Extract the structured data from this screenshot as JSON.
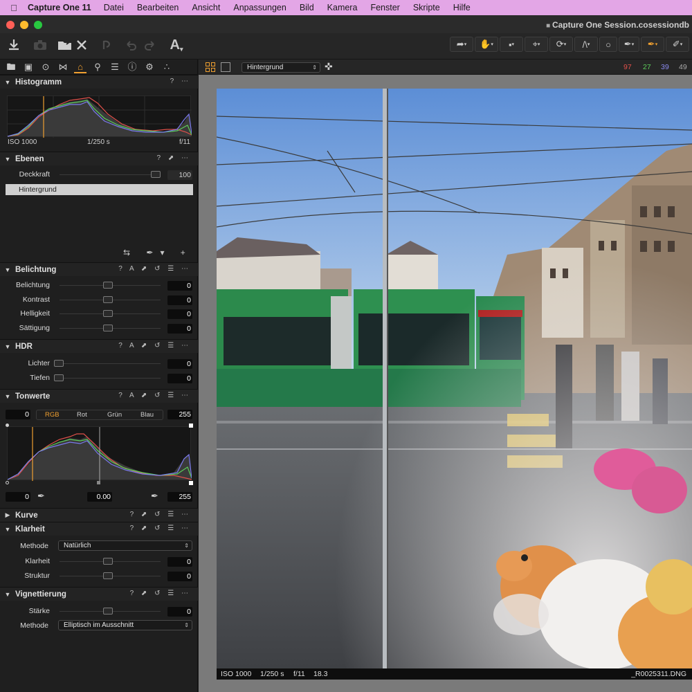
{
  "menubar": {
    "app": "Capture One 11",
    "items": [
      "Datei",
      "Bearbeiten",
      "Ansicht",
      "Anpassungen",
      "Bild",
      "Kamera",
      "Fenster",
      "Skripte",
      "Hilfe"
    ]
  },
  "window": {
    "title": "Capture One Session.cosessiondb"
  },
  "histogram": {
    "title": "Histogramm",
    "iso": "ISO 1000",
    "shutter": "1/250 s",
    "aperture": "f/11"
  },
  "layers": {
    "title": "Ebenen",
    "opacity_label": "Deckkraft",
    "opacity_value": "100",
    "layer_name": "Hintergrund"
  },
  "exposure": {
    "title": "Belichtung",
    "rows": [
      {
        "label": "Belichtung",
        "value": "0"
      },
      {
        "label": "Kontrast",
        "value": "0"
      },
      {
        "label": "Helligkeit",
        "value": "0"
      },
      {
        "label": "Sättigung",
        "value": "0"
      }
    ]
  },
  "hdr": {
    "title": "HDR",
    "rows": [
      {
        "label": "Lichter",
        "value": "0"
      },
      {
        "label": "Tiefen",
        "value": "0"
      }
    ]
  },
  "levels": {
    "title": "Tonwerte",
    "low": "0",
    "high": "255",
    "channels": [
      "RGB",
      "Rot",
      "Grün",
      "Blau"
    ],
    "out_low": "0",
    "mid": "0.00",
    "out_high": "255"
  },
  "curve": {
    "title": "Kurve"
  },
  "clarity": {
    "title": "Klarheit",
    "method_label": "Methode",
    "method_value": "Natürlich",
    "rows": [
      {
        "label": "Klarheit",
        "value": "0"
      },
      {
        "label": "Struktur",
        "value": "0"
      }
    ]
  },
  "vignette": {
    "title": "Vignettierung",
    "strength_label": "Stärke",
    "strength_value": "0",
    "method_label": "Methode",
    "method_value": "Elliptisch im Ausschnitt"
  },
  "viewer": {
    "variant": "Hintergrund",
    "count_red": "97",
    "count_green": "27",
    "count_blue": "39",
    "count_gray": "49",
    "info_iso": "ISO 1000",
    "info_shutter": "1/250 s",
    "info_aperture": "f/11",
    "info_focal": "18.3",
    "filename": "_R0025311.DNG",
    "colors": {
      "accent": "#f0a030",
      "red": "#e0504a",
      "green": "#5ccc5a",
      "blue": "#7a7aee"
    }
  }
}
